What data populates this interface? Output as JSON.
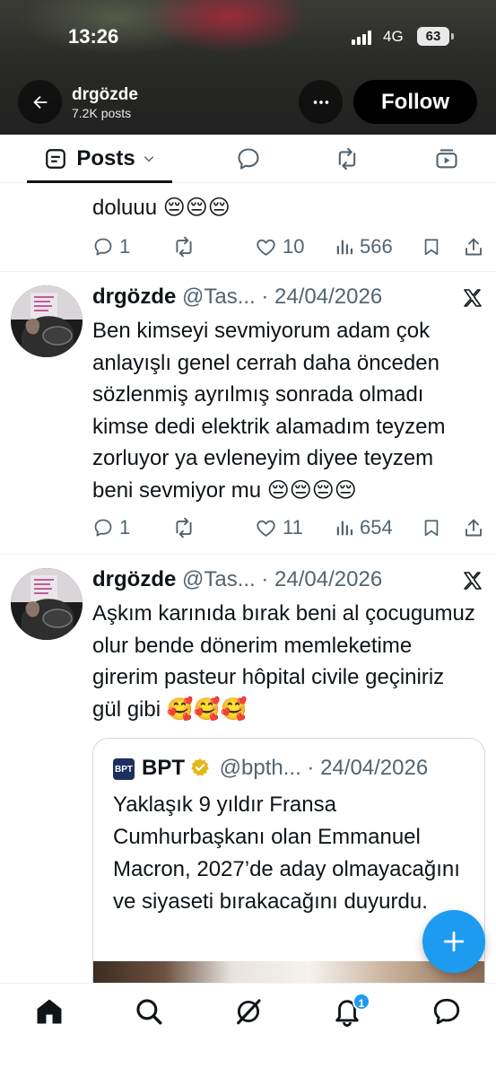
{
  "status_bar": {
    "time": "13:26",
    "network": "4G",
    "battery": "63"
  },
  "header": {
    "name": "drgözde",
    "post_count": "7.2K posts",
    "follow_label": "Follow"
  },
  "tabs": {
    "posts_label": "Posts"
  },
  "previous_post": {
    "text_tail": "doluuu 😔😔😔",
    "replies": "1",
    "likes": "10",
    "views": "566"
  },
  "posts": [
    {
      "name": "drgözde",
      "meta": "@Tas... · 24/04/2026",
      "text": "Ben kimseyi sevmiyorum adam çok anlayışlı genel cerrah daha önceden sözlenmiş ayrılmış sonrada olmadı kimse dedi elektrik alamadım teyzem zorluyor ya evleneyim diyee teyzem beni sevmiyor mu 😔😔😔😔",
      "replies": "1",
      "likes": "11",
      "views": "654"
    },
    {
      "name": "drgözde",
      "meta": "@Tas... · 24/04/2026",
      "text": "Aşkım karınıda bırak beni al çocugumuz olur bende dönerim memleketime girerim pasteur hôpital civile geçiniriz gül gibi 🥰🥰🥰",
      "quote": {
        "logo_text": "BPT",
        "name": "BPT",
        "meta": "@bpth... · 24/04/2026",
        "text": "Yaklaşık 9 yıldır Fransa Cumhurbaşkanı olan Emmanuel Macron, 2027’de aday olmayacağını ve siyaseti bırakacağını duyurdu."
      }
    }
  ],
  "bottom_nav": {
    "notifications_badge": "1"
  },
  "colors": {
    "accent": "#1d9bf0",
    "text": "#0f1419",
    "muted": "#536471",
    "border": "#eff3f4"
  }
}
